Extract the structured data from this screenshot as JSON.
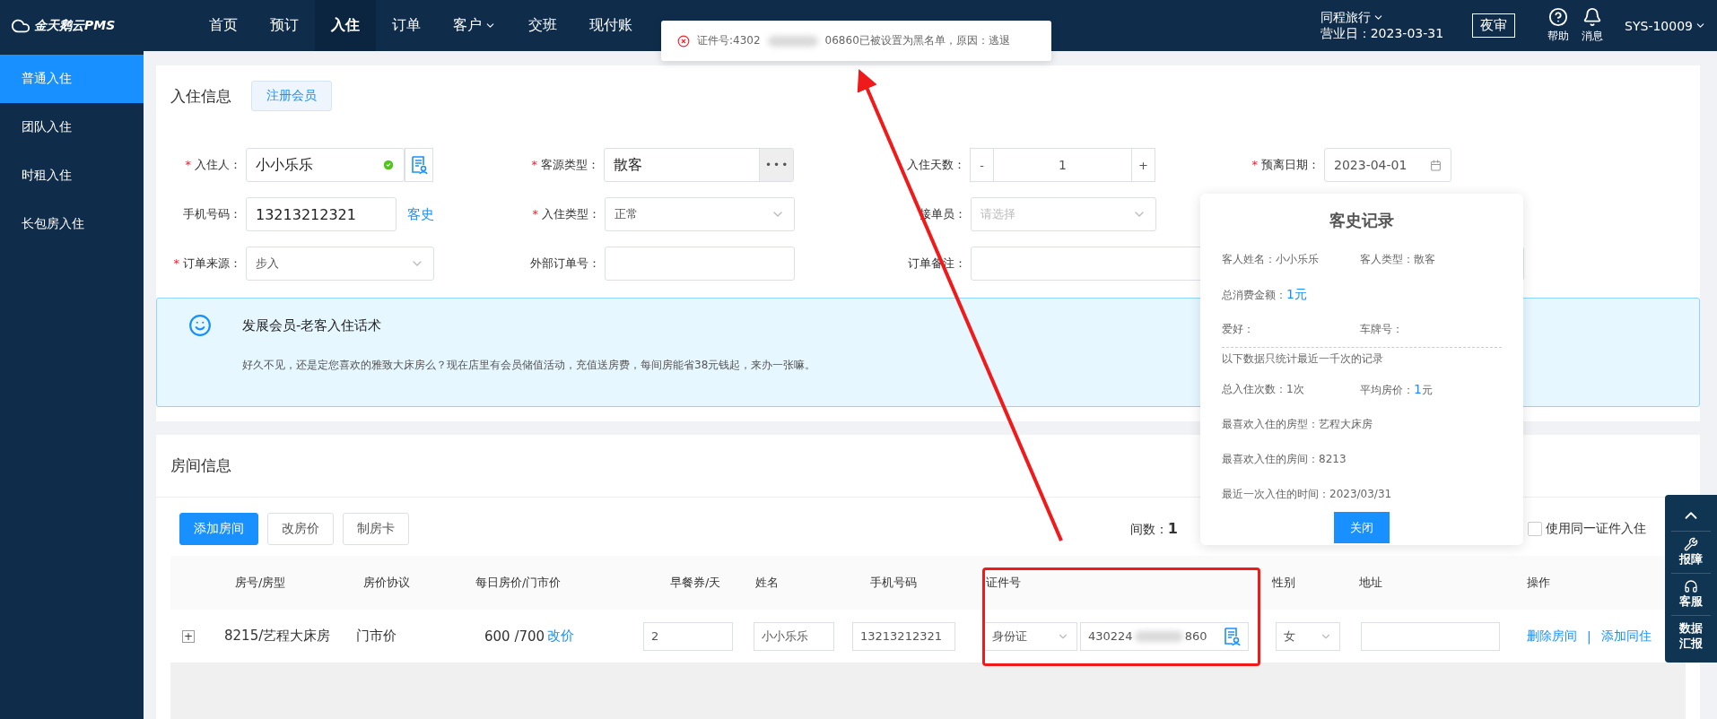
{
  "app": {
    "logo": "金天鹅云PMS"
  },
  "nav": [
    {
      "label": "首页",
      "selected": false,
      "dropdown": false
    },
    {
      "label": "预订",
      "selected": false,
      "dropdown": false
    },
    {
      "label": "入住",
      "selected": true,
      "dropdown": false
    },
    {
      "label": "订单",
      "selected": false,
      "dropdown": false
    },
    {
      "label": "客户",
      "selected": false,
      "dropdown": true
    },
    {
      "label": "交班",
      "selected": false,
      "dropdown": false
    },
    {
      "label": "现付账",
      "selected": false,
      "dropdown": false
    }
  ],
  "header_right": {
    "company": "同程旅行",
    "business_date": "营业日：2023-03-31",
    "night_audit": "夜审",
    "help": "帮助",
    "messages": "消息",
    "user": "SYS-10009"
  },
  "toast": {
    "prefix": "证件号:4302",
    "suffix": "06860已被设置为黑名单，原因：逃退"
  },
  "sidebar": {
    "items": [
      {
        "label": "普通入住",
        "selected": true
      },
      {
        "label": "团队入住",
        "selected": false
      },
      {
        "label": "时租入住",
        "selected": false
      },
      {
        "label": "长包房入住",
        "selected": false
      }
    ]
  },
  "checkin_info": {
    "title": "入住信息",
    "register_button": "注册会员",
    "required_mark": "*",
    "rows": [
      [
        {
          "kind": "guest",
          "label": "入住人：",
          "required": true,
          "value": "小小乐乐",
          "verified": true
        },
        {
          "kind": "picker",
          "label": "客源类型：",
          "required": true,
          "value": "散客",
          "more": "•••"
        },
        {
          "kind": "stepper",
          "label": "入住天数：",
          "required": false,
          "value": "1",
          "minus": "-",
          "plus": "+"
        },
        {
          "kind": "date",
          "label": "预离日期：",
          "required": true,
          "value": "2023-04-01"
        }
      ],
      [
        {
          "kind": "text",
          "label": "手机号码：",
          "required": false,
          "value": "13213212321",
          "link": "客史"
        },
        {
          "kind": "select",
          "label": "入住类型：",
          "required": true,
          "value": "正常"
        },
        {
          "kind": "select",
          "label": "接单员：",
          "required": false,
          "placeholder": "请选择"
        }
      ],
      [
        {
          "kind": "select",
          "label": "订单来源：",
          "required": true,
          "value": "步入"
        },
        {
          "kind": "text",
          "label": "外部订单号：",
          "required": false
        },
        {
          "kind": "remark",
          "label": "订单备注：",
          "required": false
        }
      ]
    ]
  },
  "banner": {
    "title": "发展会员-老客入住话术",
    "text": "好久不见，还是定您喜欢的雅致大床房么？现在店里有会员储值活动，充值送房费，每间房能省38元钱起，来办一张嘛。"
  },
  "rooms": {
    "title": "房间信息",
    "buttons": [
      {
        "label": "添加房间",
        "primary": true
      },
      {
        "label": "改房价",
        "primary": false
      },
      {
        "label": "制房卡",
        "primary": false
      }
    ],
    "count_label": "间数：",
    "count": "1",
    "same_id": {
      "label": "使用同一证件入住",
      "checked": false
    },
    "columns": [
      "房号/房型",
      "房价协议",
      "每日房价/门市价",
      "早餐券/天",
      "姓名",
      "手机号码",
      "证件号",
      "性别",
      "地址",
      "操作"
    ],
    "rows": [
      {
        "expand": "+",
        "room": "8215/艺程大床房",
        "rate_plan": "门市价",
        "price": "600 /700",
        "change_price": "改价",
        "breakfast": "2",
        "name": "小小乐乐",
        "phone": "13213212321",
        "id_type": "身份证",
        "id_prefix": "430224",
        "id_suffix": "860",
        "gender": "女",
        "actions": [
          "删除房间",
          "添加同住"
        ],
        "separator": "|"
      }
    ]
  },
  "history": {
    "title": "客史记录",
    "rows": [
      [
        {
          "label": "客人姓名：",
          "value": "小小乐乐",
          "highlight": false
        },
        {
          "label": "客人类型：",
          "value": "散客",
          "highlight": false
        }
      ],
      [
        {
          "label": "总消费金额：",
          "value": "1元",
          "highlight": true
        }
      ],
      [
        {
          "label": "爱好：",
          "highlight": false
        },
        {
          "label": "车牌号：",
          "highlight": false
        }
      ],
      [
        {
          "kind": "note",
          "label": "以下数据只统计最近一千次的记录"
        }
      ],
      [
        {
          "label": "总入住次数：",
          "value": "1次",
          "highlight": false
        },
        {
          "label": "平均房价：",
          "value": "1",
          "unit": "元",
          "highlight": true
        }
      ],
      [
        {
          "label": "最喜欢入住的房型：",
          "value": "艺程大床房",
          "highlight": false
        }
      ],
      [
        {
          "label": "最喜欢入住的房间：",
          "value": "8213",
          "highlight": false
        }
      ],
      [
        {
          "label": "最近一次入住的时间：",
          "value": "2023/03/31",
          "highlight": false
        }
      ]
    ],
    "close": "关闭"
  },
  "float_tools": [
    {
      "kind": "top"
    },
    {
      "kind": "repair",
      "label": "报障"
    },
    {
      "kind": "service",
      "label": "客服"
    },
    {
      "kind": "report",
      "label": "数据汇报"
    }
  ]
}
